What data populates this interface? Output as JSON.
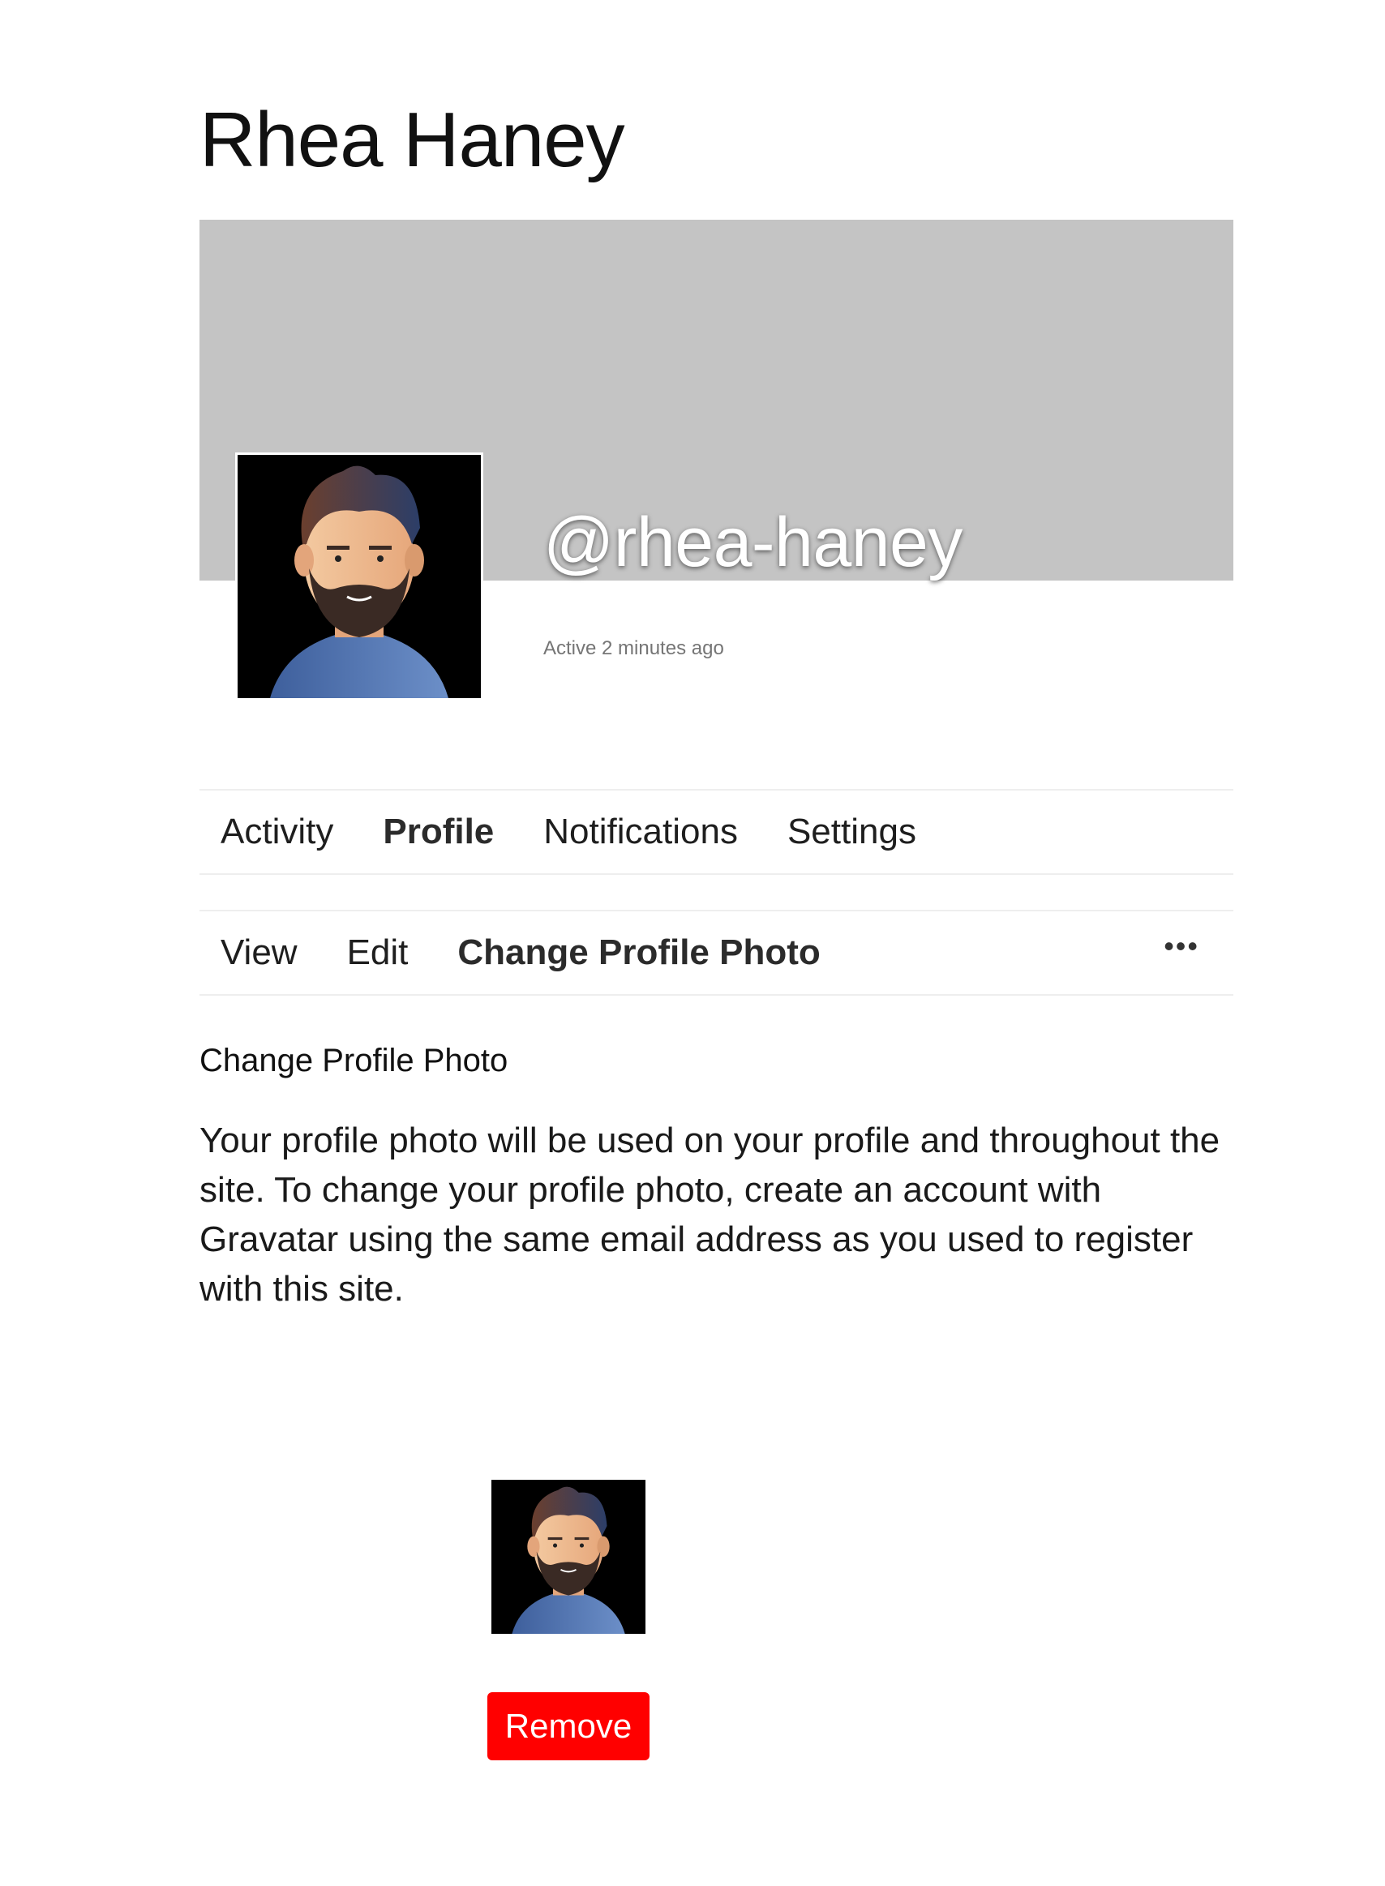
{
  "page_title": "Rhea Haney",
  "profile": {
    "handle": "@rhea-haney",
    "active_status": "Active 2 minutes ago",
    "avatar_icon": "bearded-man-avatar-icon"
  },
  "primary_nav": {
    "items": [
      {
        "label": "Activity",
        "current": false
      },
      {
        "label": "Profile",
        "current": true
      },
      {
        "label": "Notifications",
        "current": false
      },
      {
        "label": "Settings",
        "current": false
      }
    ]
  },
  "secondary_nav": {
    "items": [
      {
        "label": "View",
        "current": false
      },
      {
        "label": "Edit",
        "current": false
      },
      {
        "label": "Change Profile Photo",
        "current": true
      }
    ],
    "more_label": "•••"
  },
  "content": {
    "heading": "Change Profile Photo",
    "description": "Your profile photo will be used on your profile and throughout the site. To change your profile photo, create an account with Gravatar using the same email address as you used to register with this site.",
    "remove_label": "Remove"
  },
  "colors": {
    "cover": "#c4c4c4",
    "remove_button": "#ff0000",
    "border": "#eeeeee"
  }
}
